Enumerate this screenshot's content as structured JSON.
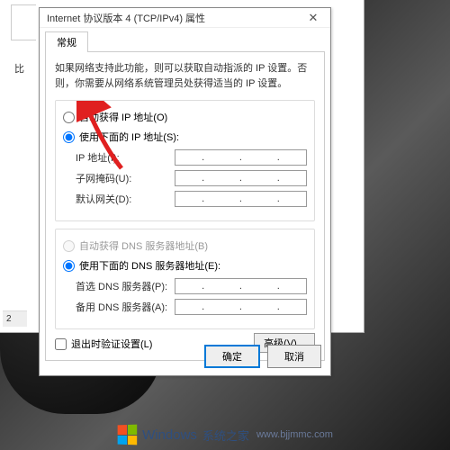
{
  "dialog": {
    "title": "Internet 协议版本 4 (TCP/IPv4) 属性",
    "close": "✕",
    "tab": "常规",
    "description": "如果网络支持此功能，则可以获取自动指派的 IP 设置。否则，你需要从网络系统管理员处获得适当的 IP 设置。",
    "ip_group": {
      "auto_label": "自动获得 IP 地址(O)",
      "manual_label": "使用下面的 IP 地址(S):",
      "ip_label": "IP 地址(I):",
      "mask_label": "子网掩码(U):",
      "gateway_label": "默认网关(D):"
    },
    "dns_group": {
      "auto_label": "自动获得 DNS 服务器地址(B)",
      "manual_label": "使用下面的 DNS 服务器地址(E):",
      "primary_label": "首选 DNS 服务器(P):",
      "alt_label": "备用 DNS 服务器(A):"
    },
    "validate_label": "退出时验证设置(L)",
    "advanced": "高级(V)...",
    "ok": "确定",
    "cancel": "取消"
  },
  "back": {
    "char": "比",
    "slice": "2"
  },
  "watermark": {
    "main": "Windows",
    "sub": "系统之家",
    "url": "www.bjjmmc.com"
  }
}
